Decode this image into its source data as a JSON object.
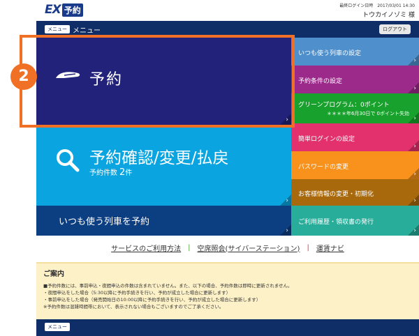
{
  "header": {
    "logo_ex": "EX",
    "logo_yoyaku": "予約",
    "last_login": "最終ログイン日時　2017/03/01 14:30",
    "user_name": "トウカイノゾミ 様"
  },
  "navbar": {
    "menu_pill": "メニュー",
    "title": "メニュー",
    "logout": "ログアウト"
  },
  "tiles": {
    "yoyaku": {
      "label": "予約",
      "icon": "train-icon",
      "color": "#22227a"
    },
    "kakunin": {
      "label": "予約確認/変更/払戻",
      "sub_prefix": "予約件数",
      "count": "2",
      "count_unit": "件",
      "icon": "search-icon",
      "color": "#0aa5e0"
    },
    "itsumo_yoyaku": {
      "label": "いつも使う列車を予約",
      "color": "#0c3e82"
    }
  },
  "side_menu": [
    {
      "label": "いつも使う列車の設定",
      "color": "#4e8fcc"
    },
    {
      "label": "予約条件の設定",
      "color": "#9c2a8a"
    },
    {
      "label": "グリーンプログラム：0ポイント",
      "sub": "＊＊＊＊年6月30日で 0ポイント失効",
      "color": "#18a12c"
    },
    {
      "label": "簡単ログインの設定",
      "color": "#e3316e"
    },
    {
      "label": "パスワードの変更",
      "color": "#f8921c"
    },
    {
      "label": "お客様情報の変更・初期化",
      "color": "#a8690d"
    },
    {
      "label": "ご利用履歴・領収書の発行",
      "color": "#27ad9a"
    }
  ],
  "links": {
    "items": [
      "サービスのご利用方法",
      "空席照会(サイバーステーション)",
      "運賃ナビ"
    ],
    "separators": [
      "|",
      "|"
    ]
  },
  "notice": {
    "title": "ご案内",
    "lines": [
      "■予約件数には、事前申込・夜間申込の件数は含まれていません。また、以下の場合、予約件数は即時に更新されません。",
      "・夜間申込をした場合（5:30以降に予約手続きを行い、予約が成立した場合に更新します）",
      "・事前申込をした場合（発売開始日の10:00以降に予約手続きを行い、予約が成立した場合に更新します）",
      "※予約件数は混雑時間帯において、表示されない場合もございますのでご了承ください。"
    ]
  },
  "footer": {
    "menu_pill": "メニュー"
  },
  "step_badge": "2",
  "colors": {
    "highlight": "#f07126",
    "navy": "#0f2d66"
  }
}
